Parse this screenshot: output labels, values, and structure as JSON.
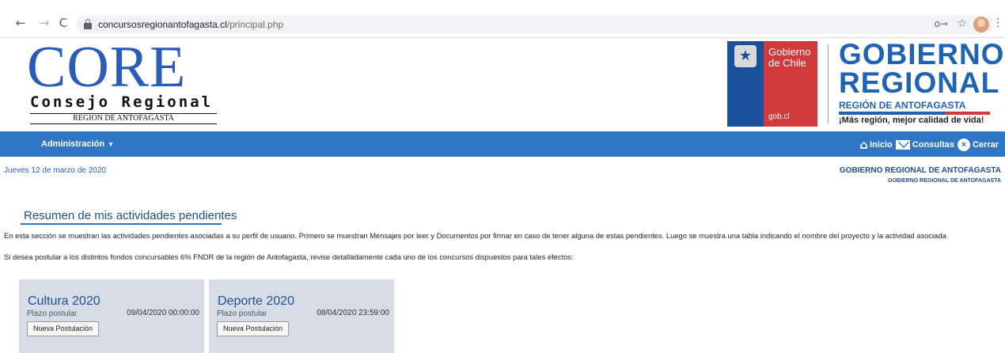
{
  "browser": {
    "back_icon": "←",
    "forward_icon": "→",
    "reload_icon": "C",
    "url_domain": "concursosregionantofagasta.cl",
    "url_path": "/principal.php",
    "key_icon": "o⊸",
    "star_icon": "☆",
    "menu_icon": "⋮"
  },
  "header": {
    "core_word": "CORE",
    "core_subtitle": "Consejo Regional",
    "core_region": "REGION DE ANTOFAGASTA",
    "gob_chile_line1": "Gobierno",
    "gob_chile_line2": "de Chile",
    "gob_cl": "gob.cl",
    "gore_line1": "GOBIERNO",
    "gore_line2": "REGIONAL",
    "gore_region": "REGIÓN DE ANTOFAGASTA",
    "gore_slogan": "¡Más región, mejor calidad de vida!"
  },
  "navbar": {
    "admin_label": "Administración",
    "inicio_label": "Inicio",
    "consultas_label": "Consultas",
    "cerrar_label": "Cerrar",
    "colors": {
      "bar": "#2f77c5"
    }
  },
  "content": {
    "date": "Jueves 12 de marzo de 2020",
    "org_line1": "GOBIERNO REGIONAL DE ANTOFAGASTA",
    "org_line2": "GOBIERNO REGIONAL DE ANTOFAGASTA",
    "section_title": "Resumen de mis actividades pendientes",
    "paragraph1": "En esta sección se muestran las actividades pendientes asociadas a su perfil de usuario. Primero se muestran Mensajes por leer y Documentos por firmar en caso de tener alguna de estas pendientes. Luego se muestra una tabla indicando el nombre del proyecto y la actividad asociada",
    "paragraph2": "Si desea postular a los distintos fondos concursables 6% FNDR de la región de Antofagasta, revise detalladamente cada uno de los concursos dispuestos para tales efectos:"
  },
  "contests": [
    {
      "title": "Cultura 2020",
      "label": "Plazo postular",
      "deadline": "09/04/2020 00:00:00",
      "button": "Nueva Postulación"
    },
    {
      "title": "Deporte 2020",
      "label": "Plazo postular",
      "deadline": "08/04/2020 23:59:00",
      "button": "Nueva Postulación"
    }
  ]
}
